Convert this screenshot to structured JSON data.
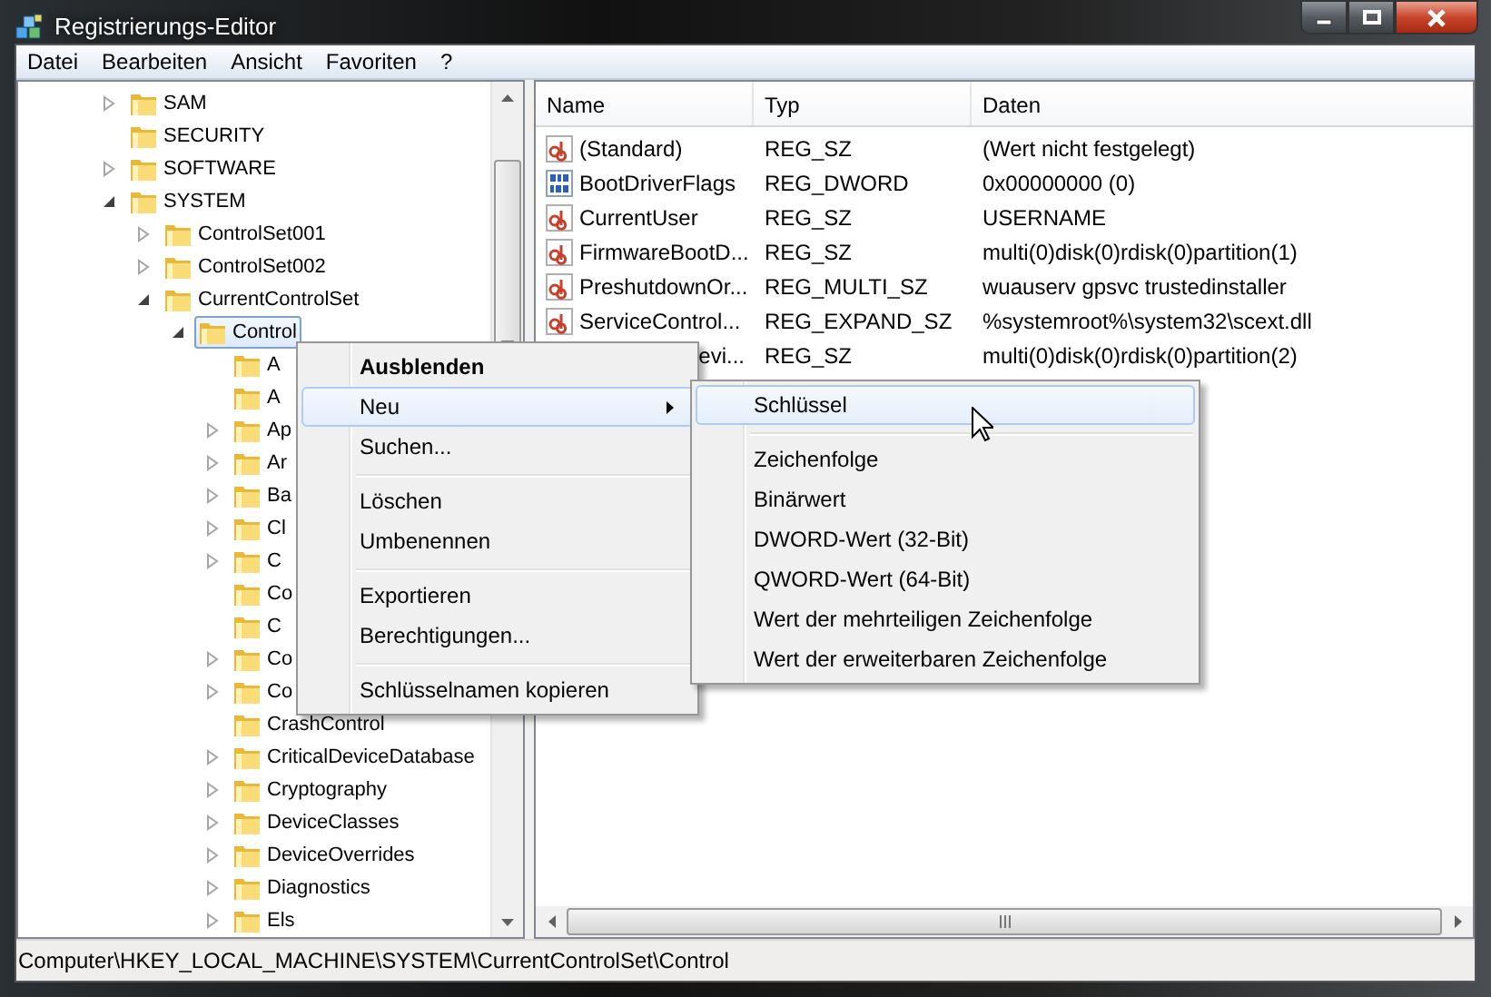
{
  "window": {
    "title": "Registrierungs-Editor"
  },
  "menu_bar": [
    {
      "label": "Datei"
    },
    {
      "label": "Bearbeiten"
    },
    {
      "label": "Ansicht"
    },
    {
      "label": "Favoriten"
    },
    {
      "label": "?"
    }
  ],
  "tree": [
    {
      "label": "SAM",
      "kind": "collapsed",
      "selected": false
    },
    {
      "label": "SECURITY",
      "kind": "leaf",
      "selected": false
    },
    {
      "label": "SOFTWARE",
      "kind": "collapsed",
      "selected": false
    },
    {
      "label": "SYSTEM",
      "kind": "expanded",
      "selected": false,
      "children": [
        {
          "label": "ControlSet001",
          "kind": "collapsed",
          "selected": false
        },
        {
          "label": "ControlSet002",
          "kind": "collapsed",
          "selected": false
        },
        {
          "label": "CurrentControlSet",
          "kind": "expanded",
          "selected": false,
          "children": [
            {
              "label": "Control",
              "kind": "expanded",
              "selected": true,
              "children": [
                {
                  "label": "A",
                  "kind": "leaf",
                  "selected": false
                },
                {
                  "label": "A",
                  "kind": "leaf",
                  "selected": false
                },
                {
                  "label": "Ap",
                  "kind": "collapsed",
                  "selected": false
                },
                {
                  "label": "Ar",
                  "kind": "collapsed",
                  "selected": false
                },
                {
                  "label": "Ba",
                  "kind": "collapsed",
                  "selected": false
                },
                {
                  "label": "Cl",
                  "kind": "collapsed",
                  "selected": false
                },
                {
                  "label": "C",
                  "kind": "collapsed",
                  "selected": false
                },
                {
                  "label": "Co",
                  "kind": "leaf",
                  "selected": false
                },
                {
                  "label": "C",
                  "kind": "leaf",
                  "selected": false
                },
                {
                  "label": "Co",
                  "kind": "collapsed",
                  "selected": false
                },
                {
                  "label": "Co",
                  "kind": "collapsed",
                  "selected": false
                },
                {
                  "label": "CrashControl",
                  "kind": "leaf",
                  "selected": false
                },
                {
                  "label": "CriticalDeviceDatabase",
                  "kind": "collapsed",
                  "selected": false
                },
                {
                  "label": "Cryptography",
                  "kind": "collapsed",
                  "selected": false
                },
                {
                  "label": "DeviceClasses",
                  "kind": "collapsed",
                  "selected": false
                },
                {
                  "label": "DeviceOverrides",
                  "kind": "collapsed",
                  "selected": false
                },
                {
                  "label": "Diagnostics",
                  "kind": "collapsed",
                  "selected": false
                },
                {
                  "label": "Els",
                  "kind": "collapsed",
                  "selected": false
                }
              ]
            }
          ]
        }
      ]
    }
  ],
  "values_table": {
    "columns": [
      "Name",
      "Typ",
      "Daten"
    ],
    "rows": [
      {
        "kind": "string",
        "name": "(Standard)",
        "type": "REG_SZ",
        "data": "(Wert nicht festgelegt)"
      },
      {
        "kind": "binary",
        "name": "BootDriverFlags",
        "type": "REG_DWORD",
        "data": "0x00000000 (0)"
      },
      {
        "kind": "string",
        "name": "CurrentUser",
        "type": "REG_SZ",
        "data": "USERNAME"
      },
      {
        "kind": "string",
        "name": "FirmwareBootD...",
        "type": "REG_SZ",
        "data": "multi(0)disk(0)rdisk(0)partition(1)"
      },
      {
        "kind": "string",
        "name": "PreshutdownOr...",
        "type": "REG_MULTI_SZ",
        "data": "wuauserv gpsvc trustedinstaller"
      },
      {
        "kind": "string",
        "name": "ServiceControl...",
        "type": "REG_EXPAND_SZ",
        "data": "%systemroot%\\system32\\scext.dll"
      },
      {
        "kind": "covered",
        "name": "evi...",
        "type": "REG_SZ",
        "data": "multi(0)disk(0)rdisk(0)partition(2)"
      }
    ]
  },
  "context_menu": {
    "items": [
      {
        "label": "Ausblenden",
        "default": true,
        "submenu": false,
        "separator_before": false,
        "selected": false
      },
      {
        "label": "Neu",
        "default": false,
        "submenu": true,
        "separator_before": false,
        "selected": true
      },
      {
        "label": "Suchen...",
        "default": false,
        "submenu": false,
        "separator_before": false,
        "selected": false
      },
      {
        "label": "Löschen",
        "default": false,
        "submenu": false,
        "separator_before": true,
        "selected": false
      },
      {
        "label": "Umbenennen",
        "default": false,
        "submenu": false,
        "separator_before": false,
        "selected": false
      },
      {
        "label": "Exportieren",
        "default": false,
        "submenu": false,
        "separator_before": true,
        "selected": false
      },
      {
        "label": "Berechtigungen...",
        "default": false,
        "submenu": false,
        "separator_before": false,
        "selected": false
      },
      {
        "label": "Schlüsselnamen kopieren",
        "default": false,
        "submenu": false,
        "separator_before": true,
        "selected": false
      }
    ]
  },
  "submenu": {
    "items": [
      {
        "label": "Schlüssel",
        "separator_before": false,
        "selected": true
      },
      {
        "label": "Zeichenfolge",
        "separator_before": true,
        "selected": false
      },
      {
        "label": "Binärwert",
        "separator_before": false,
        "selected": false
      },
      {
        "label": "DWORD-Wert (32-Bit)",
        "separator_before": false,
        "selected": false
      },
      {
        "label": "QWORD-Wert (64-Bit)",
        "separator_before": false,
        "selected": false
      },
      {
        "label": "Wert der mehrteiligen Zeichenfolge",
        "separator_before": false,
        "selected": false
      },
      {
        "label": "Wert der erweiterbaren Zeichenfolge",
        "separator_before": false,
        "selected": false
      }
    ]
  },
  "status_bar": {
    "path": "Computer\\HKEY_LOCAL_MACHINE\\SYSTEM\\CurrentControlSet\\Control"
  }
}
